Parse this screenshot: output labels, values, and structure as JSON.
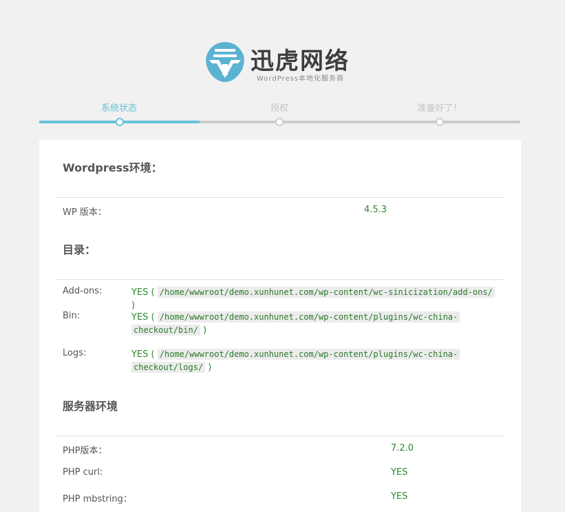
{
  "brand": {
    "name": "迅虎网络",
    "subtitle": "WordPress本地化服务商",
    "accent": "#5ab3d1"
  },
  "steps": [
    {
      "label": "系统状态",
      "active": true
    },
    {
      "label": "授权",
      "active": false
    },
    {
      "label": "准备好了！",
      "active": false
    }
  ],
  "wordpress": {
    "title": "Wordpress环境：",
    "rows": [
      {
        "label": "WP 版本：",
        "value": "4.5.3"
      }
    ]
  },
  "directories": {
    "title": "目录：",
    "rows": [
      {
        "label": "Add-ons:",
        "status": "YES",
        "path": "/home/wwwroot/demo.xunhunet.com/wp-content/wc-sinicization/add-ons/"
      },
      {
        "label": "Bin:",
        "status": "YES",
        "path_line1": "/home/wwwroot/demo.xunhunet.com/wp-content/plugins/wc-china-",
        "path_line2": "checkout/bin/"
      },
      {
        "label": "Logs:",
        "status": "YES",
        "path_line1": "/home/wwwroot/demo.xunhunet.com/wp-content/plugins/wc-china-",
        "path_line2": "checkout/logs/"
      }
    ]
  },
  "server": {
    "title": "服务器环境",
    "rows": [
      {
        "label": "PHP版本：",
        "value": "7.2.0"
      },
      {
        "label": "PHP curl:",
        "value": "YES"
      },
      {
        "label": "PHP mbstring：",
        "value": "YES"
      }
    ]
  },
  "colors": {
    "success": "#2a8a2a",
    "step_active": "#67c2d8",
    "step_inactive": "#cccccc"
  }
}
